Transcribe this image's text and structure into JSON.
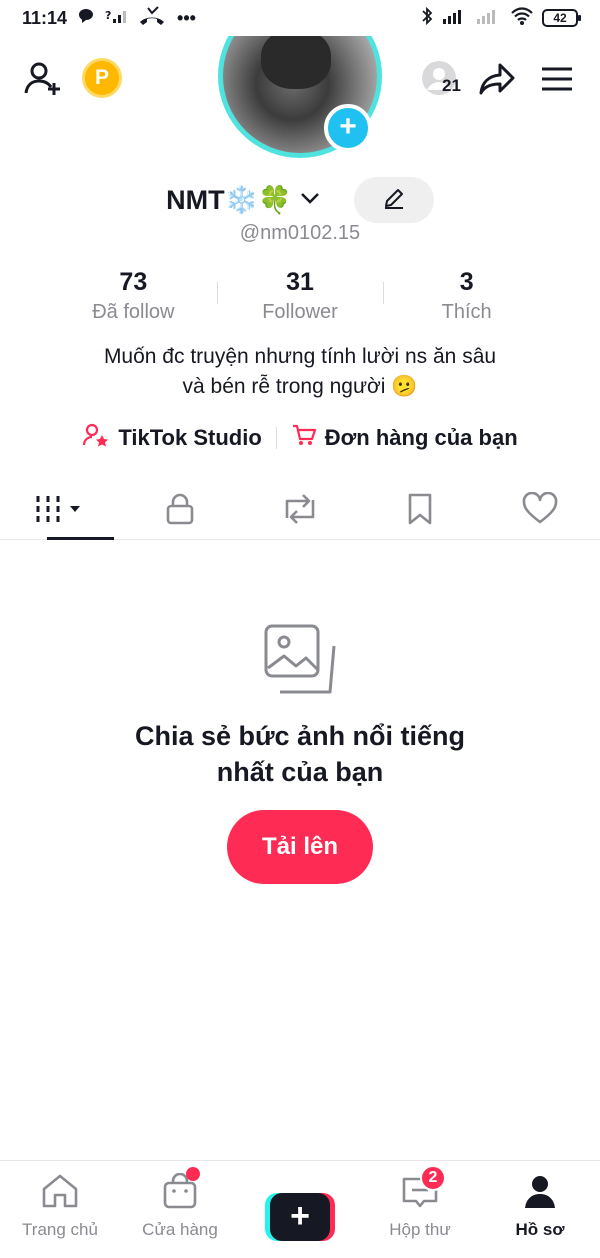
{
  "status_bar": {
    "time": "11:14",
    "dots": "•••",
    "battery": "42"
  },
  "header": {
    "coin_label": "P",
    "notifications_count": "21"
  },
  "profile": {
    "display_name": "NMT❄️🍀",
    "handle": "@nm0102.15",
    "stats": [
      {
        "value": "73",
        "label": "Đã follow"
      },
      {
        "value": "31",
        "label": "Follower"
      },
      {
        "value": "3",
        "label": "Thích"
      }
    ],
    "bio_line1": "Muốn đc truyện nhưng tính lười ns ăn sâu",
    "bio_line2": "và bén rễ trong người 🫤"
  },
  "links": {
    "studio": "TikTok Studio",
    "orders": "Đơn hàng của bạn"
  },
  "tabs": [
    "videos-grid",
    "private",
    "reposts",
    "favorites",
    "liked"
  ],
  "empty_state": {
    "line1": "Chia sẻ bức ảnh nổi tiếng",
    "line2": "nhất của bạn",
    "button": "Tải lên"
  },
  "bottom_nav": {
    "home": "Trang chủ",
    "shop": "Cửa hàng",
    "create": "+",
    "inbox": "Hộp thư",
    "inbox_badge": "2",
    "profile": "Hồ sơ"
  },
  "colors": {
    "accent": "#fe2c55",
    "avatar_ring": "#4fe3e0",
    "add_avatar": "#20c0f0",
    "coin": "#ffb800"
  }
}
